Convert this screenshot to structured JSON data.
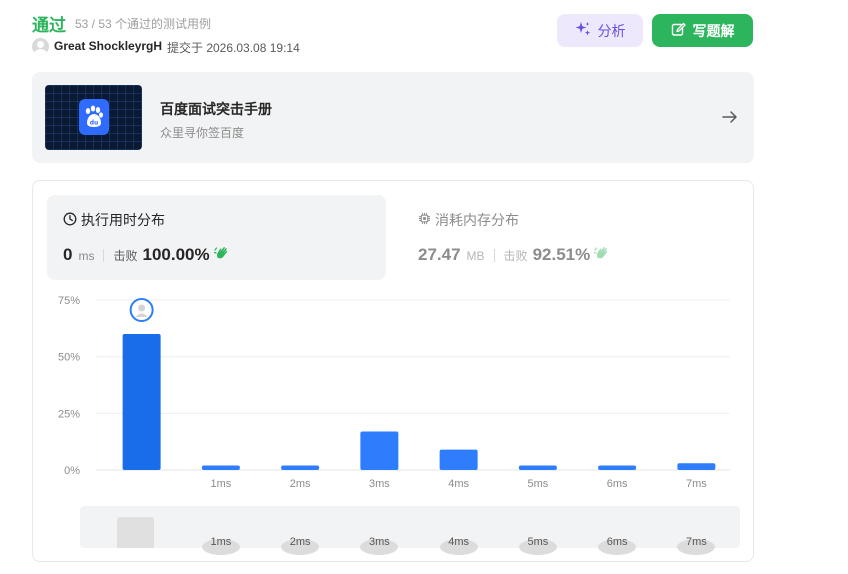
{
  "header": {
    "status": "通过",
    "pass_count": "53 / 53 个通过的测试用例",
    "user_name": "Great ShockleyrgH",
    "submit_time": "提交于 2026.03.08 19:14",
    "analyze_label": "分析",
    "solution_label": "写题解"
  },
  "promo": {
    "title": "百度面试突击手册",
    "subtitle": "众里寻你签百度"
  },
  "runtime": {
    "title": "执行用时分布",
    "value": "0",
    "unit": "ms",
    "beat_label": "击败",
    "beat": "100.00%"
  },
  "memory": {
    "title": "消耗内存分布",
    "value": "27.47",
    "unit": "MB",
    "beat_label": "击败",
    "beat": "92.51%"
  },
  "colors": {
    "accent_green": "#2db55d",
    "bar_highlight": "#1a6de8",
    "bar": "#2d7dfc",
    "analyze": "#6c4fe0"
  },
  "chart_data": {
    "type": "bar",
    "categories": [
      "",
      "1ms",
      "2ms",
      "3ms",
      "4ms",
      "5ms",
      "6ms",
      "7ms"
    ],
    "values": [
      60,
      2,
      2,
      17,
      9,
      2,
      2,
      3
    ],
    "ylim": [
      0,
      75
    ],
    "yticks": [
      "0%",
      "25%",
      "50%",
      "75%"
    ],
    "ytick_values": [
      0,
      25,
      50,
      75
    ],
    "highlight_index": 0,
    "grid": true
  },
  "slider_labels": [
    "1ms",
    "2ms",
    "3ms",
    "4ms",
    "5ms",
    "6ms",
    "7ms"
  ]
}
